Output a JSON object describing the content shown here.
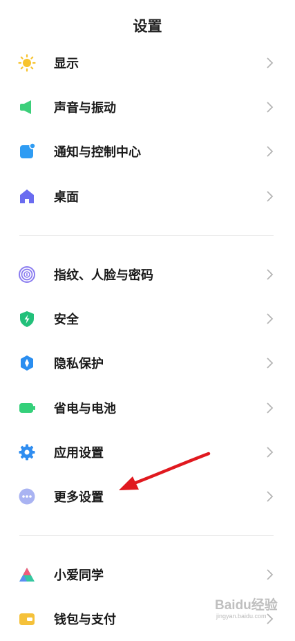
{
  "header": {
    "title": "设置"
  },
  "sections": [
    {
      "items": [
        {
          "label": "显示",
          "icon": "sun-icon",
          "color": "#f7c32e"
        },
        {
          "label": "声音与振动",
          "icon": "speaker-icon",
          "color": "#3ccf7a"
        },
        {
          "label": "通知与控制中心",
          "icon": "notification-icon",
          "color": "#2f9cf3"
        },
        {
          "label": "桌面",
          "icon": "home-icon",
          "color": "#6a6cf0"
        }
      ]
    },
    {
      "items": [
        {
          "label": "指纹、人脸与密码",
          "icon": "fingerprint-icon",
          "color": "#8a7cf0"
        },
        {
          "label": "安全",
          "icon": "shield-icon",
          "color": "#22c07a"
        },
        {
          "label": "隐私保护",
          "icon": "privacy-icon",
          "color": "#2a8ef0"
        },
        {
          "label": "省电与电池",
          "icon": "battery-icon",
          "color": "#34d07a"
        },
        {
          "label": "应用设置",
          "icon": "gear-icon",
          "color": "#2f8df0"
        },
        {
          "label": "更多设置",
          "icon": "more-icon",
          "color": "#a9b3f2"
        }
      ]
    },
    {
      "items": [
        {
          "label": "小爱同学",
          "icon": "xiaoai-icon",
          "color": "#36c7a0"
        },
        {
          "label": "钱包与支付",
          "icon": "wallet-icon",
          "color": "#f5c13a"
        }
      ]
    }
  ],
  "annotation": {
    "arrow_color": "#e0191f"
  },
  "watermark": {
    "text": "Baidu经验",
    "sub": "jingyan.baidu.com"
  }
}
